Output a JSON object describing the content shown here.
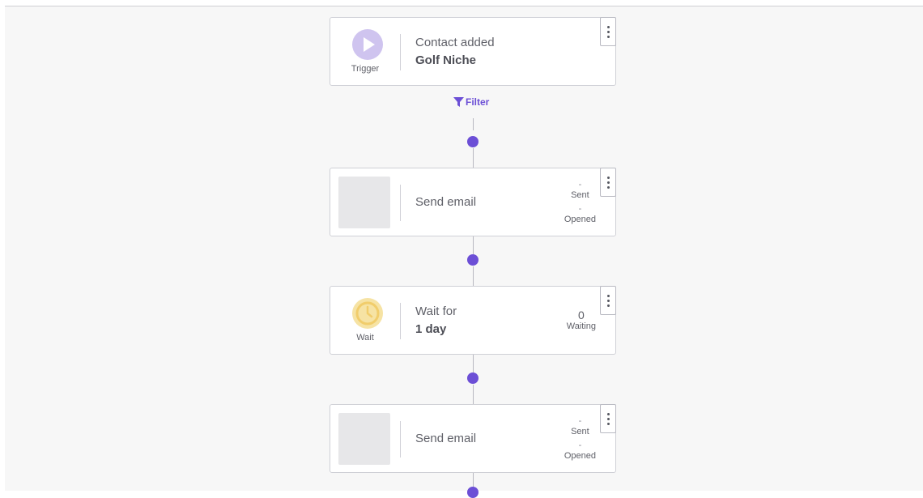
{
  "colors": {
    "accent": "#6c4fd6",
    "trigger_icon_bg": "#cfc4ef",
    "wait_icon": "#f1cd6b"
  },
  "filter": {
    "label": "Filter",
    "icon": "funnel-icon"
  },
  "steps": [
    {
      "kind": "trigger",
      "icon": "play-icon",
      "icon_label": "Trigger",
      "line1": "Contact added",
      "line2": "Golf Niche"
    },
    {
      "kind": "send-email",
      "line1": "Send email",
      "stats": [
        {
          "value": "-",
          "label": "Sent"
        },
        {
          "value": "-",
          "label": "Opened"
        }
      ]
    },
    {
      "kind": "wait",
      "icon": "clock-icon",
      "icon_label": "Wait",
      "line1": "Wait for",
      "line2": "1 day",
      "stats": [
        {
          "value": "0",
          "label": "Waiting"
        }
      ]
    },
    {
      "kind": "send-email",
      "line1": "Send email",
      "stats": [
        {
          "value": "-",
          "label": "Sent"
        },
        {
          "value": "-",
          "label": "Opened"
        }
      ]
    }
  ]
}
